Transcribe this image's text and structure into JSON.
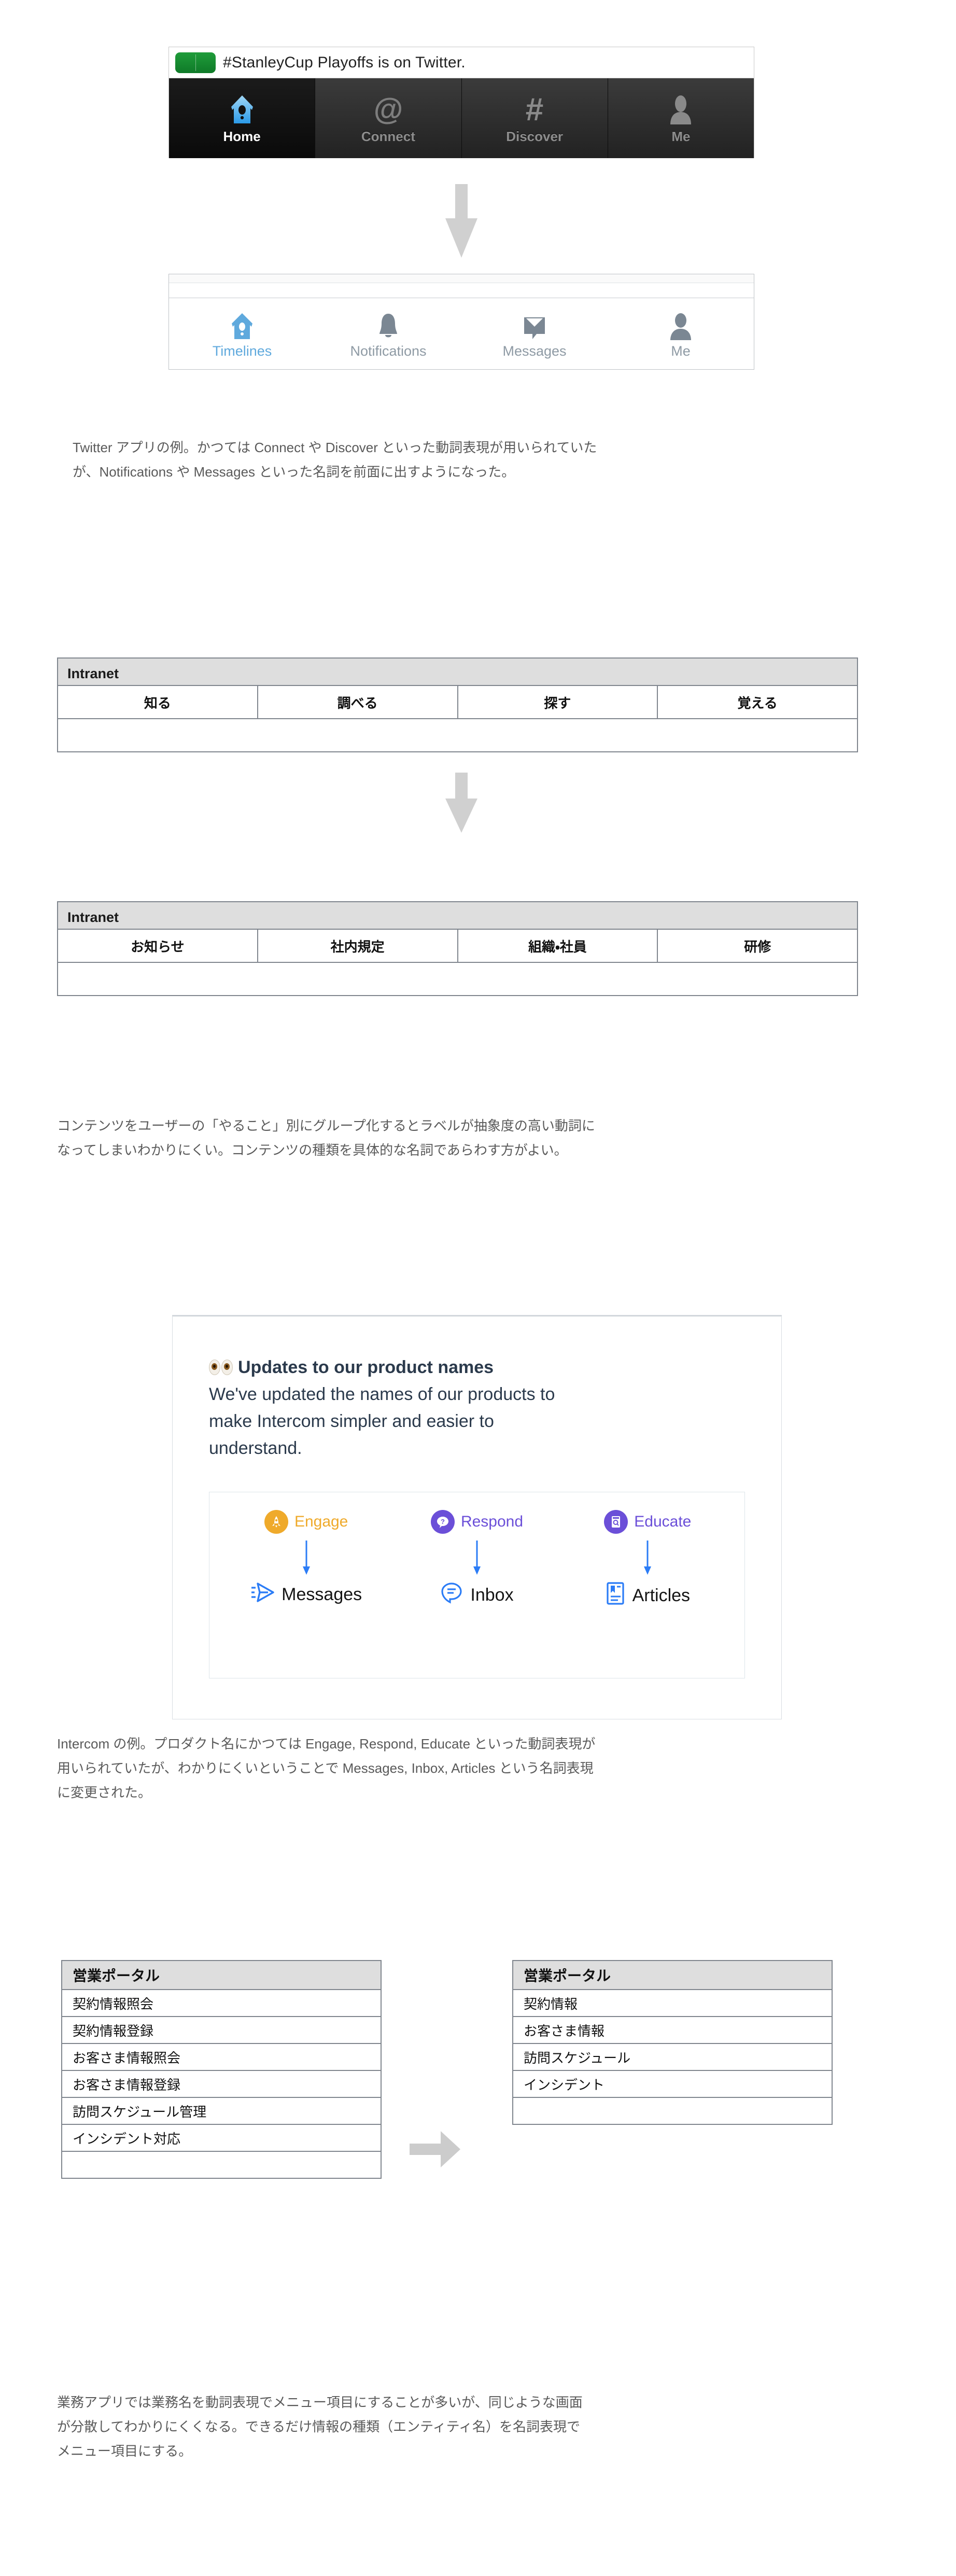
{
  "figure1": {
    "old_app": {
      "promo_text": "#StanleyCup Playoffs is on Twitter.",
      "promo_thumb_icon": "green-video-thumbnail",
      "tabs": [
        {
          "label": "Home",
          "icon": "home-birdhouse-icon",
          "active": true
        },
        {
          "label": "Connect",
          "icon": "at-sign-icon",
          "active": false
        },
        {
          "label": "Discover",
          "icon": "hashtag-icon",
          "active": false
        },
        {
          "label": "Me",
          "icon": "person-icon",
          "active": false
        }
      ]
    },
    "new_app": {
      "tabs": [
        {
          "label": "Timelines",
          "icon": "home-birdhouse-icon",
          "active": true
        },
        {
          "label": "Notifications",
          "icon": "bell-icon",
          "active": false
        },
        {
          "label": "Messages",
          "icon": "envelope-icon",
          "active": false
        },
        {
          "label": "Me",
          "icon": "person-icon",
          "active": false
        }
      ]
    },
    "arrow_icon": "down-arrow-icon"
  },
  "caption1": {
    "line1": "Twitter アプリの例。かつては Connect や Discover といった動詞表現が用いられていた",
    "line2": "が、Notifications や Messages といった名詞を前面に出すようになった。"
  },
  "figure2": {
    "before": {
      "title": "Intranet",
      "tabs": [
        "知る",
        "調べる",
        "探す",
        "覚える"
      ]
    },
    "after": {
      "title": "Intranet",
      "tabs": [
        "お知らせ",
        "社内規定",
        "組織・社員",
        "研修"
      ]
    },
    "arrow_icon": "down-arrow-icon"
  },
  "caption2": {
    "line1": "コンテンツをユーザーの「やること」別にグループ化するとラベルが抽象度の高い動詞に",
    "line2": "なってしまいわかりにくい。コンテンツの種類を具体的な名詞であらわす方がよい。"
  },
  "figure3": {
    "eyes_icon": "eyes-emoji-icon",
    "heading": "Updates to our product names",
    "body_line1": "We've updated the names of our products to",
    "body_line2": "make Intercom simpler and easier to",
    "body_line3": "understand.",
    "pairs": [
      {
        "old_label": "Engage",
        "old_icon": "rocket-icon",
        "old_color": "#efaa2b",
        "new_label": "Messages",
        "new_icon": "paper-plane-icon",
        "new_color": "#2b7cf6",
        "arrow_icon": "down-arrow-icon"
      },
      {
        "old_label": "Respond",
        "old_icon": "question-speech-bubble-icon",
        "old_color": "#6b4fd8",
        "new_label": "Inbox",
        "new_icon": "chat-lines-icon",
        "new_color": "#2b7cf6",
        "arrow_icon": "down-arrow-icon"
      },
      {
        "old_label": "Educate",
        "old_icon": "search-document-icon",
        "old_color": "#6b4fd8",
        "new_label": "Articles",
        "new_icon": "article-page-icon",
        "new_color": "#2b7cf6",
        "arrow_icon": "down-arrow-icon"
      }
    ]
  },
  "caption3": {
    "line1": "Intercom の例。プロダクト名にかつては Engage, Respond, Educate といった動詞表現が",
    "line2": "用いられていたが、わかりにくいということで Messages, Inbox, Articles という名詞表現",
    "line3": "に変更された。"
  },
  "figure4": {
    "before": {
      "title": "営業ポータル",
      "items": [
        "契約情報照会",
        "契約情報登録",
        "お客さま情報照会",
        "お客さま情報登録",
        "訪問スケジュール管理",
        "インシデント対応"
      ]
    },
    "after": {
      "title": "営業ポータル",
      "items": [
        "契約情報",
        "お客さま情報",
        "訪問スケジュール",
        "インシデント"
      ]
    },
    "arrow_icon": "right-arrow-icon"
  },
  "caption4": {
    "line1": "業務アプリでは業務名を動詞表現でメニュー項目にすることが多いが、同じような画面",
    "line2": "が分散してわかりにくくなる。できるだけ情報の種類（エンティティ名）を名詞表現で",
    "line3": "メニュー項目にする。"
  },
  "colors": {
    "table_border": "#80868e",
    "table_header_bg": "#dedede",
    "arrow_gray": "#cccccc",
    "twitter_blue": "#5fa9dd",
    "intercom_orange": "#efaa2b",
    "intercom_purple": "#6b4fd8",
    "intercom_blue": "#2b7cf6"
  }
}
